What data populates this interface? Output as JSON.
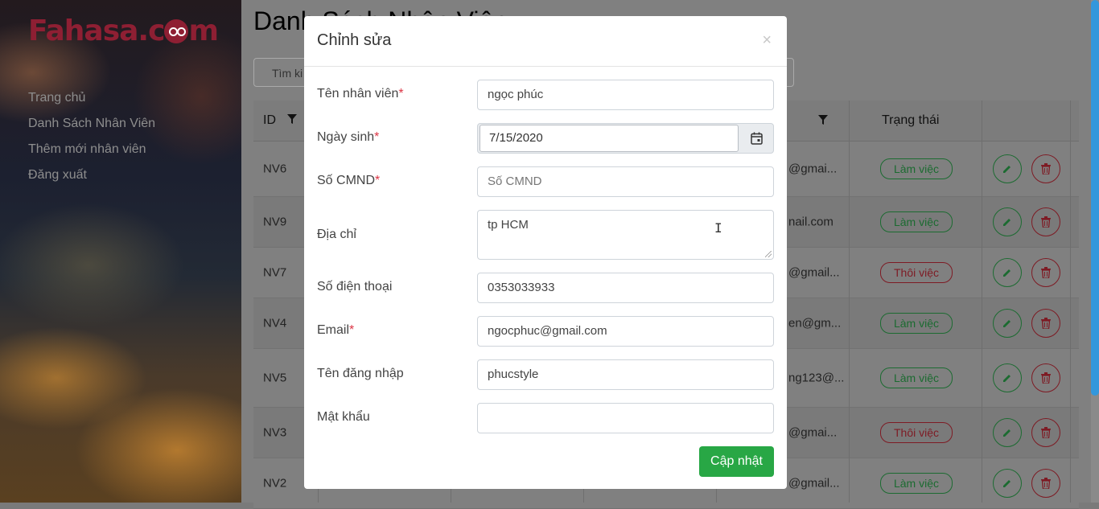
{
  "brand": {
    "logo_text_1": "Fahasa.c",
    "logo_text_2": "m",
    "color": "#8e1f33"
  },
  "sidebar": {
    "items": [
      {
        "label": "Trang chủ"
      },
      {
        "label": "Danh Sách Nhân Viên"
      },
      {
        "label": "Thêm mới nhân viên"
      },
      {
        "label": "Đăng xuất"
      }
    ]
  },
  "main": {
    "title": "Danh Sách Nhân Viên",
    "search_placeholder": "Tìm ki",
    "columns": {
      "id": "ID",
      "status": "Trạng thái"
    },
    "rows": [
      {
        "id": "NV6",
        "email": "@gmai...",
        "status": "Làm việc",
        "active": true
      },
      {
        "id": "NV9",
        "email": "nail.com",
        "status": "Làm việc",
        "active": true
      },
      {
        "id": "NV7",
        "email": "@gmail...",
        "status": "Thôi việc",
        "active": false
      },
      {
        "id": "NV4",
        "email": "en@gm...",
        "status": "Làm việc",
        "active": true
      },
      {
        "id": "NV5",
        "email": "ng123@...",
        "status": "Làm việc",
        "active": true
      },
      {
        "id": "NV3",
        "email": "@gmai...",
        "status": "Thôi việc",
        "active": false
      },
      {
        "id": "NV2",
        "email": "@gmail...",
        "status": "Làm việc",
        "active": true
      }
    ]
  },
  "modal": {
    "title": "Chỉnh sửa",
    "close": "×",
    "fields": {
      "name": {
        "label": "Tên nhân viên",
        "required": "*",
        "value": "ngọc phúc"
      },
      "birthday": {
        "label": "Ngày sinh",
        "required": "*",
        "value": "7/15/2020"
      },
      "id_card": {
        "label": "Số CMND",
        "required": "*",
        "placeholder": "Số CMND"
      },
      "address": {
        "label": "Địa chỉ",
        "value": "tp HCM"
      },
      "phone": {
        "label": "Số điện thoại",
        "value": "0353033933"
      },
      "email": {
        "label": "Email",
        "required": "*",
        "value": "ngocphuc@gmail.com"
      },
      "username": {
        "label": "Tên đăng nhập",
        "value": "phucstyle"
      },
      "password": {
        "label": "Mật khẩu",
        "value": ""
      }
    },
    "submit_label": "Cập nhật"
  },
  "colors": {
    "success": "#28a745",
    "danger": "#dc3545",
    "scrollbar": "#3397dc"
  }
}
